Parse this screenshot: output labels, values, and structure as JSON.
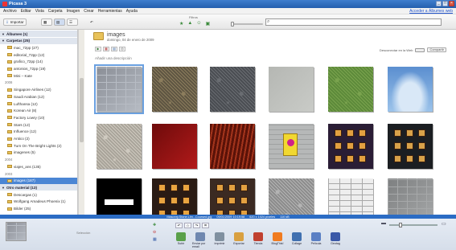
{
  "window": {
    "title": "Picasa 3"
  },
  "menu": {
    "items": [
      "Archivo",
      "Editar",
      "Vista",
      "Carpeta",
      "Imagen",
      "Crear",
      "Herramientas",
      "Ayuda"
    ],
    "signin": "Acceder a Álbumes web"
  },
  "toolbar": {
    "import_label": "Importar",
    "filter_label": "Filtros",
    "search_value": ""
  },
  "sidebar": {
    "items": [
      {
        "type": "header",
        "label": "Álbumes (1)"
      },
      {
        "type": "header",
        "label": "Carpetas (25)"
      },
      {
        "type": "folder",
        "label": "mac_72pp (27)"
      },
      {
        "type": "folder",
        "label": "editorial_72pp (12)"
      },
      {
        "type": "folder",
        "label": "grafico_72pp (14)"
      },
      {
        "type": "folder",
        "label": "antonios_72pp (19)"
      },
      {
        "type": "folder",
        "label": "Mini – Kate"
      },
      {
        "type": "year",
        "label": "2008"
      },
      {
        "type": "folder",
        "label": "Singapore Airlines (12)"
      },
      {
        "type": "folder",
        "label": "Saudi Arabian (12)"
      },
      {
        "type": "folder",
        "label": "Lufthansa (12)"
      },
      {
        "type": "folder",
        "label": "Korean Air (8)"
      },
      {
        "type": "folder",
        "label": "Factory Lowry (10)"
      },
      {
        "type": "folder",
        "label": "Stars (12)"
      },
      {
        "type": "folder",
        "label": "Influence (12)"
      },
      {
        "type": "folder",
        "label": "Antico (2)"
      },
      {
        "type": "folder",
        "label": "Turn On The Bright Lights (2)"
      },
      {
        "type": "folder",
        "label": "imagenes (5)"
      },
      {
        "type": "year",
        "label": "2004"
      },
      {
        "type": "folder",
        "label": "viajes_ans (135)"
      },
      {
        "type": "year",
        "label": "2003"
      },
      {
        "type": "selected",
        "label": "images (187)"
      },
      {
        "type": "header",
        "label": "Otro material (13)"
      },
      {
        "type": "folder",
        "label": "Descargas (1)"
      },
      {
        "type": "folder",
        "label": "Wolfgang Amadeus Phoenix (1)"
      },
      {
        "type": "folder",
        "label": "Bilder (25)"
      }
    ]
  },
  "album": {
    "title": "images",
    "date": "domingo, 04 de enero de 2009",
    "add_description": "Añadir una descripción",
    "web_share_label": "Desconectar en la Web",
    "share_label": "Compartir"
  },
  "photos": [
    {
      "name": "stone-wall",
      "colors": [
        "#8a8e96",
        "#b7bcc4"
      ],
      "pattern": "bricks",
      "selected": true
    },
    {
      "name": "gravel",
      "colors": [
        "#5e5542",
        "#8c7d5d"
      ],
      "pattern": "noise"
    },
    {
      "name": "asphalt",
      "colors": [
        "#4a4d52",
        "#6a6d72"
      ],
      "pattern": "noise"
    },
    {
      "name": "concrete",
      "colors": [
        "#b5b7b3",
        "#c9cbc7"
      ],
      "pattern": "flat"
    },
    {
      "name": "grass",
      "colors": [
        "#5d8a3a",
        "#7aa34e"
      ],
      "pattern": "noise"
    },
    {
      "name": "sky",
      "colors": [
        "#5b8fd0",
        "#d9e8f7"
      ],
      "pattern": "sky"
    },
    {
      "name": "plaster",
      "colors": [
        "#a9a49a",
        "#cfcac0"
      ],
      "pattern": "noise"
    },
    {
      "name": "red-fabric",
      "colors": [
        "#6e0b0b",
        "#b21a1a"
      ],
      "pattern": "flat"
    },
    {
      "name": "red-wood",
      "colors": [
        "#5a1208",
        "#a3341c"
      ],
      "pattern": "stripes"
    },
    {
      "name": "sign-wall",
      "colors": [
        "#b6b8b8",
        "#f1d830"
      ],
      "pattern": "sign"
    },
    {
      "name": "building-night",
      "colors": [
        "#2a1d35",
        "#e2a040"
      ],
      "pattern": "windows"
    },
    {
      "name": "building-dark",
      "colors": [
        "#1b1e22",
        "#d8a24a"
      ],
      "pattern": "windows"
    },
    {
      "name": "black-box",
      "colors": [
        "#000000",
        "#ffffff"
      ],
      "pattern": "blackbar"
    },
    {
      "name": "facade-a",
      "colors": [
        "#2a1b14",
        "#e8a440"
      ],
      "pattern": "windows"
    },
    {
      "name": "facade-b",
      "colors": [
        "#3b2a22",
        "#e2a040"
      ],
      "pattern": "windows"
    },
    {
      "name": "gray-stone",
      "colors": [
        "#8c8c8c",
        "#b4b4b4"
      ],
      "pattern": "noise"
    },
    {
      "name": "white-brick",
      "colors": [
        "#eeeeee",
        "#a8a8a8"
      ],
      "pattern": "whitebrick"
    },
    {
      "name": "gray-brick",
      "colors": [
        "#7d7f80",
        "#a6a8a9"
      ],
      "pattern": "bricks"
    }
  ],
  "status": {
    "filename": "Masonry.Stone.Lim...Coursed.jpg",
    "date": "09/01/2009 10:19:58",
    "dimensions": "620 x 1024 píxeles",
    "size": "110 kB"
  },
  "tray": {
    "label": "Selección",
    "actions": [
      {
        "label": "Subir",
        "icon": "upload-icon",
        "color": "#5aa04a"
      },
      {
        "label": "Enviar por email",
        "icon": "email-icon",
        "color": "#7088b0"
      },
      {
        "label": "Imprimir",
        "icon": "print-icon",
        "color": "#8090a0"
      },
      {
        "label": "Exportar",
        "icon": "export-icon",
        "color": "#d9a040"
      },
      {
        "label": "Tienda",
        "icon": "shop-icon",
        "color": "#c04030"
      },
      {
        "label": "BlogThis!",
        "icon": "blog-icon",
        "color": "#f07b20"
      },
      {
        "label": "Collage",
        "icon": "collage-icon",
        "color": "#4070b0"
      },
      {
        "label": "Película",
        "icon": "movie-icon",
        "color": "#5a7fc4"
      },
      {
        "label": "Geotag",
        "icon": "geotag-icon",
        "color": "#3a58a8"
      }
    ]
  }
}
